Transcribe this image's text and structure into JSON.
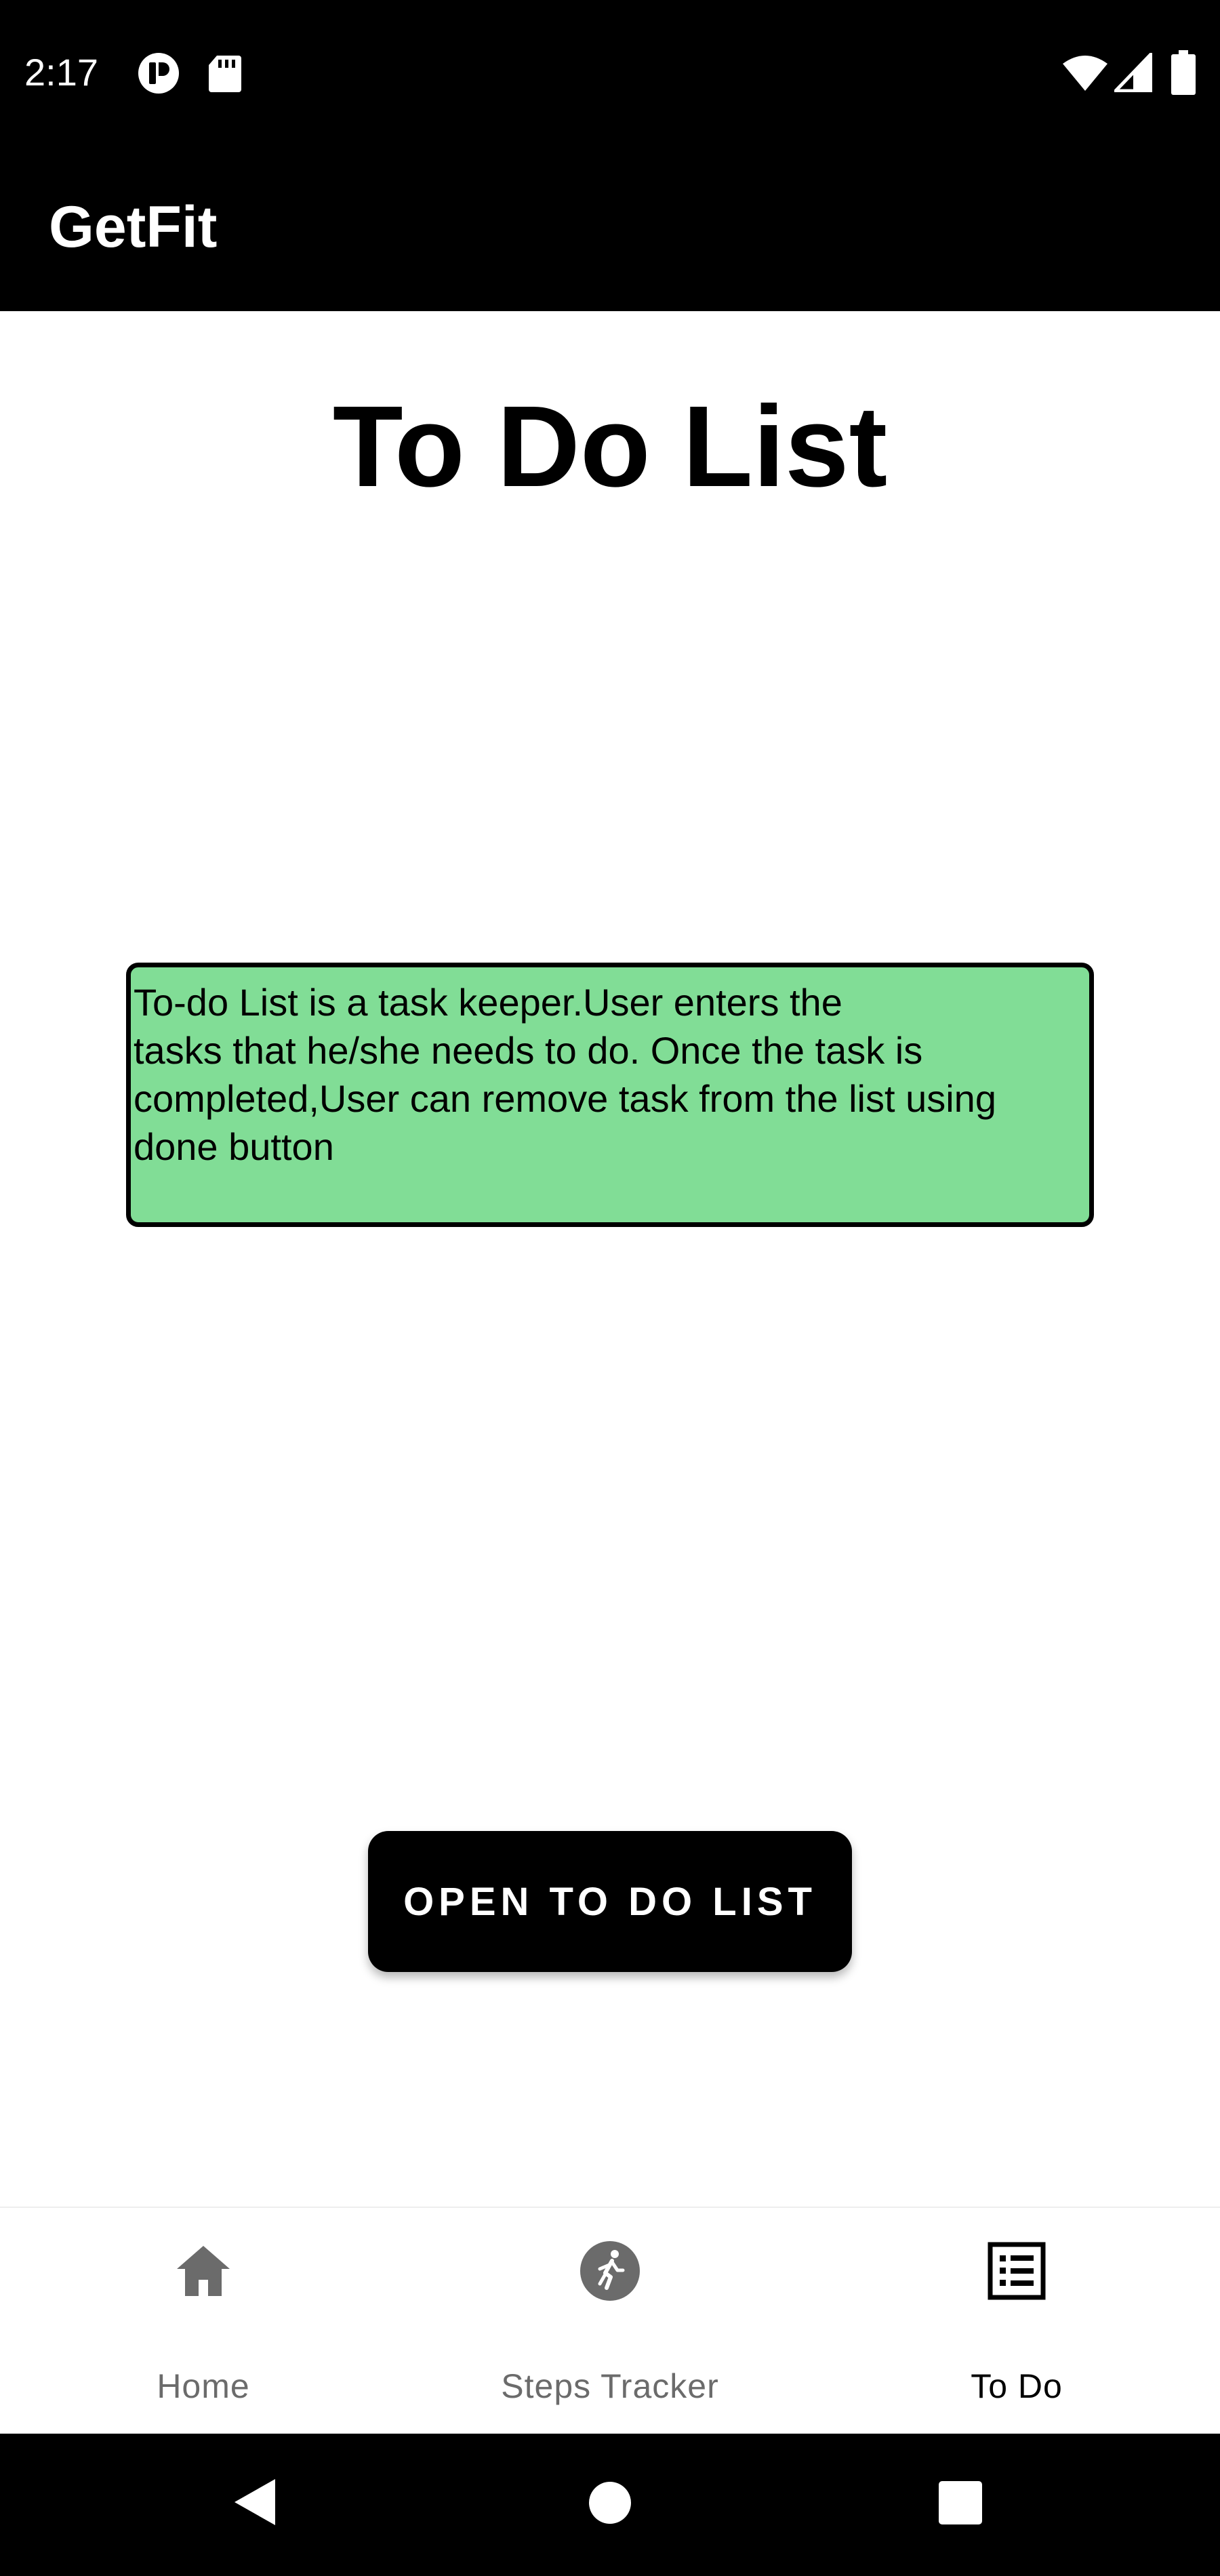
{
  "status_bar": {
    "time": "2:17",
    "icons": [
      "media-app-icon",
      "sd-card-icon",
      "wifi-icon",
      "signal-icon",
      "battery-icon"
    ]
  },
  "app_bar": {
    "title": "GetFit"
  },
  "main": {
    "page_title": "To Do List",
    "description_lines": [
      "To-do List is a task keeper.User enters the",
      "tasks that he/she needs to do. Once the task is",
      "completed,User can remove task from the list using",
      "done button"
    ],
    "description_bg": "#81dd96",
    "open_button_label": "OPEN TO DO LIST"
  },
  "bottom_nav": {
    "items": [
      {
        "label": "Home",
        "icon": "home-icon",
        "active": false
      },
      {
        "label": "Steps Tracker",
        "icon": "running-icon",
        "active": false
      },
      {
        "label": "To Do",
        "icon": "list-icon",
        "active": true
      }
    ],
    "inactive_color": "#6b6b6b",
    "active_color": "#000000"
  },
  "system_nav": {
    "icons": [
      "back-icon",
      "home-circle-icon",
      "recents-icon"
    ]
  }
}
